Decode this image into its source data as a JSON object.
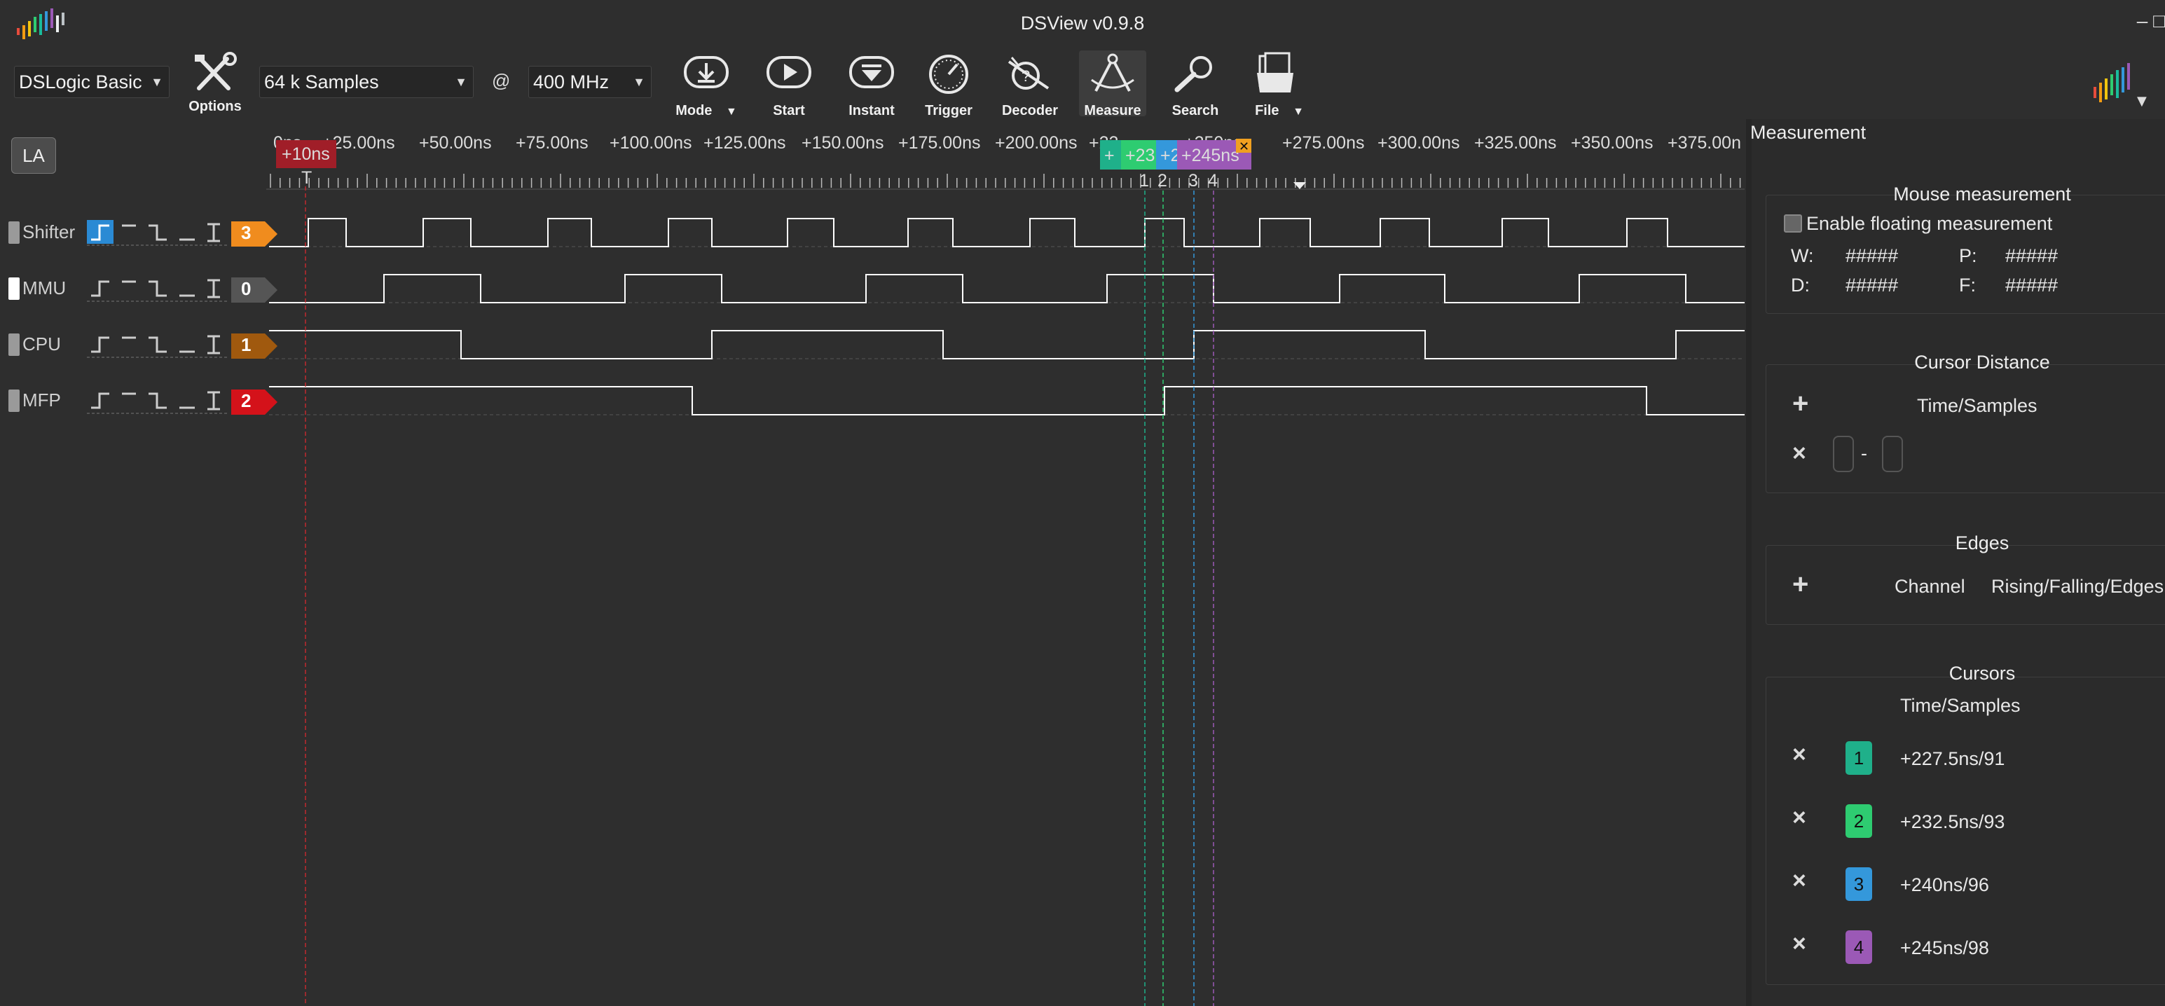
{
  "window": {
    "title": "DSView v0.9.8",
    "controls": "– □"
  },
  "toolbar": {
    "device": "DSLogic Basic",
    "options_label": "Options",
    "samples": "64 k Samples",
    "at": "@",
    "frequency": "400 MHz",
    "buttons": {
      "mode": "Mode",
      "start": "Start",
      "instant": "Instant",
      "trigger": "Trigger",
      "decoder": "Decoder",
      "measure": "Measure",
      "search": "Search",
      "file": "File"
    }
  },
  "la_label": "LA",
  "ruler": {
    "tick_labels": [
      "0ns",
      "+25.00ns",
      "+50.00ns",
      "+75.00ns",
      "+100.00ns",
      "+125.00ns",
      "+150.00ns",
      "+175.00ns",
      "+200.00ns",
      "+22",
      "+250ns",
      "+275.00ns",
      "+300.00ns",
      "+325.00ns",
      "+350.00ns",
      "+375.00n"
    ],
    "trigger_label": "+10ns",
    "trigger_marker": "T",
    "cursor_overlay_labels": [
      "+",
      "+23",
      "+2",
      "+245ns"
    ],
    "cursor_numbers": [
      "1",
      "2",
      "3",
      "4"
    ]
  },
  "channels": [
    {
      "name": "Shifter",
      "index": "3",
      "color": "#f08c1e"
    },
    {
      "name": "MMU",
      "index": "0",
      "color": "#555555"
    },
    {
      "name": "CPU",
      "index": "1",
      "color": "#a0590e"
    },
    {
      "name": "MFP",
      "index": "2",
      "color": "#d4121a"
    }
  ],
  "panel": {
    "title": "Measurement",
    "mouse": {
      "title": "Mouse measurement",
      "floating_label": "Enable floating measurement",
      "w_label": "W:",
      "w_value": "#####",
      "p_label": "P:",
      "p_value": "#####",
      "d_label": "D:",
      "d_value": "#####",
      "f_label": "F:",
      "f_value": "#####"
    },
    "cursor_distance": {
      "title": "Cursor Distance",
      "column": "Time/Samples",
      "dash": "-"
    },
    "edges": {
      "title": "Edges",
      "col_channel": "Channel",
      "col_edges": "Rising/Falling/Edges"
    },
    "cursors": {
      "title": "Cursors",
      "column": "Time/Samples",
      "items": [
        {
          "num": "1",
          "value": "+227.5ns/91",
          "color": "#1fb08a"
        },
        {
          "num": "2",
          "value": "+232.5ns/93",
          "color": "#2ecc71"
        },
        {
          "num": "3",
          "value": "+240ns/96",
          "color": "#3498db"
        },
        {
          "num": "4",
          "value": "+245ns/98",
          "color": "#9b59b6"
        }
      ]
    }
  },
  "colors": {
    "background": "#2e2e2e",
    "trigger": "#c0282e",
    "wave": "#ffffff"
  }
}
